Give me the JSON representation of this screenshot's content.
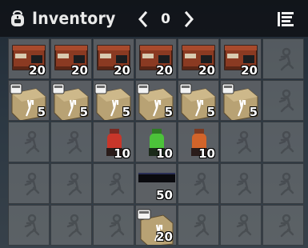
{
  "header": {
    "title": "Inventory",
    "page": "0"
  },
  "slots": [
    {
      "item": "crate",
      "count": "20"
    },
    {
      "item": "crate",
      "count": "20"
    },
    {
      "item": "crate",
      "count": "20"
    },
    {
      "item": "crate",
      "count": "20"
    },
    {
      "item": "crate",
      "count": "20"
    },
    {
      "item": "crate",
      "count": "20"
    },
    {
      "item": "empty",
      "count": ""
    },
    {
      "item": "ration",
      "count": "5"
    },
    {
      "item": "ration",
      "count": "5"
    },
    {
      "item": "ration",
      "count": "5"
    },
    {
      "item": "ration",
      "count": "5"
    },
    {
      "item": "ration",
      "count": "5"
    },
    {
      "item": "ration",
      "count": "5"
    },
    {
      "item": "empty",
      "count": ""
    },
    {
      "item": "empty",
      "count": ""
    },
    {
      "item": "empty",
      "count": ""
    },
    {
      "item": "red-grenade",
      "count": "10"
    },
    {
      "item": "green-grenade",
      "count": "10"
    },
    {
      "item": "orange-grenade",
      "count": "10"
    },
    {
      "item": "empty",
      "count": ""
    },
    {
      "item": "empty",
      "count": ""
    },
    {
      "item": "empty",
      "count": ""
    },
    {
      "item": "empty",
      "count": ""
    },
    {
      "item": "empty",
      "count": ""
    },
    {
      "item": "black-bar",
      "count": "50"
    },
    {
      "item": "empty",
      "count": ""
    },
    {
      "item": "empty",
      "count": ""
    },
    {
      "item": "empty",
      "count": ""
    },
    {
      "item": "empty",
      "count": ""
    },
    {
      "item": "empty",
      "count": ""
    },
    {
      "item": "empty",
      "count": ""
    },
    {
      "item": "single-ration",
      "count": "20"
    },
    {
      "item": "empty",
      "count": ""
    },
    {
      "item": "empty",
      "count": ""
    },
    {
      "item": "empty",
      "count": ""
    }
  ],
  "colors": {
    "header_bg": "#0f1216",
    "text": "#e9e9e9",
    "crate": "#8a3a22",
    "ration_box": "#b8a274",
    "red": "#c8362a",
    "green": "#4cc33a",
    "orange": "#d2642a"
  }
}
